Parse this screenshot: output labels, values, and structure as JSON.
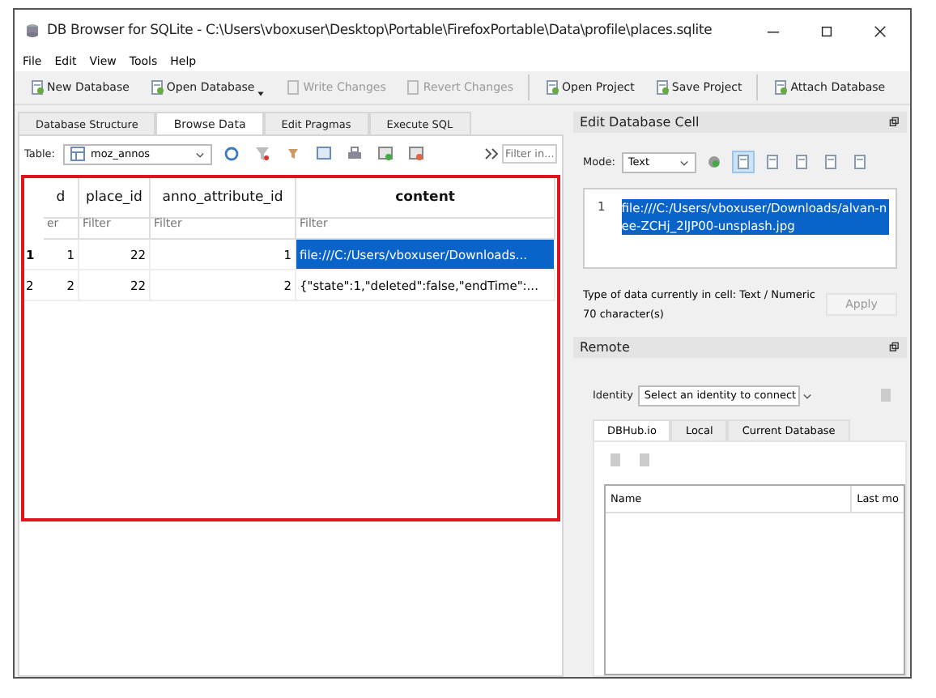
{
  "window": {
    "title": "DB Browser for SQLite - C:\\Users\\vboxuser\\Desktop\\Portable\\FirefoxPortable\\Data\\profile\\places.sqlite"
  },
  "menu": [
    "File",
    "Edit",
    "View",
    "Tools",
    "Help"
  ],
  "toolbar": [
    {
      "label": "New Database",
      "disabled": false,
      "dropdown": false
    },
    {
      "label": "Open Database",
      "disabled": false,
      "dropdown": true
    },
    {
      "label": "Write Changes",
      "disabled": true,
      "dropdown": false
    },
    {
      "label": "Revert Changes",
      "disabled": true,
      "dropdown": false
    },
    {
      "label": "Open Project",
      "disabled": false,
      "dropdown": false
    },
    {
      "label": "Save Project",
      "disabled": false,
      "dropdown": false
    },
    {
      "label": "Attach Database",
      "disabled": false,
      "dropdown": false
    }
  ],
  "tabs": [
    {
      "label": "Database Structure",
      "selected": false
    },
    {
      "label": "Browse Data",
      "selected": true
    },
    {
      "label": "Edit Pragmas",
      "selected": false
    },
    {
      "label": "Execute SQL",
      "selected": false
    }
  ],
  "table_bar": {
    "label": "Table:",
    "table": "moz_annos",
    "filter_placeholder": "Filter in..."
  },
  "grid": {
    "columns": [
      "d",
      "place_id",
      "anno_attribute_id",
      "content"
    ],
    "filter_placeholders": [
      "er",
      "Filter",
      "Filter",
      "Filter"
    ],
    "rows": [
      {
        "number": "1",
        "selected": true,
        "cells": [
          {
            "text": "1",
            "selected": false
          },
          {
            "text": "22",
            "selected": false
          },
          {
            "text": "1",
            "selected": false
          },
          {
            "text": "file:///C:/Users/vboxuser/Downloads...",
            "selected": true
          }
        ]
      },
      {
        "number": "2",
        "selected": false,
        "cells": [
          {
            "text": "2",
            "selected": false
          },
          {
            "text": "22",
            "selected": false
          },
          {
            "text": "2",
            "selected": false
          },
          {
            "text": "{\"state\":1,\"deleted\":false,\"endTime\":...",
            "selected": false
          }
        ]
      }
    ]
  },
  "edit_cell": {
    "title": "Edit Database Cell",
    "mode_label": "Mode:",
    "mode": "Text",
    "line_number": "1",
    "value": "file:///C:/Users/vboxuser/Downloads/alvan-nee-ZCHj_2lJP00-unsplash.jpg",
    "type_info": "Type of data currently in cell: Text / Numeric",
    "char_count": "70 character(s)",
    "apply": {
      "label": "Apply",
      "disabled": true
    }
  },
  "remote": {
    "title": "Remote",
    "identity_label": "Identity",
    "identity": "Select an identity to connect",
    "tabs": [
      {
        "label": "DBHub.io",
        "selected": true
      },
      {
        "label": "Local",
        "selected": false
      },
      {
        "label": "Current Database",
        "selected": false
      }
    ],
    "columns": [
      "Name",
      "Last mo"
    ]
  }
}
